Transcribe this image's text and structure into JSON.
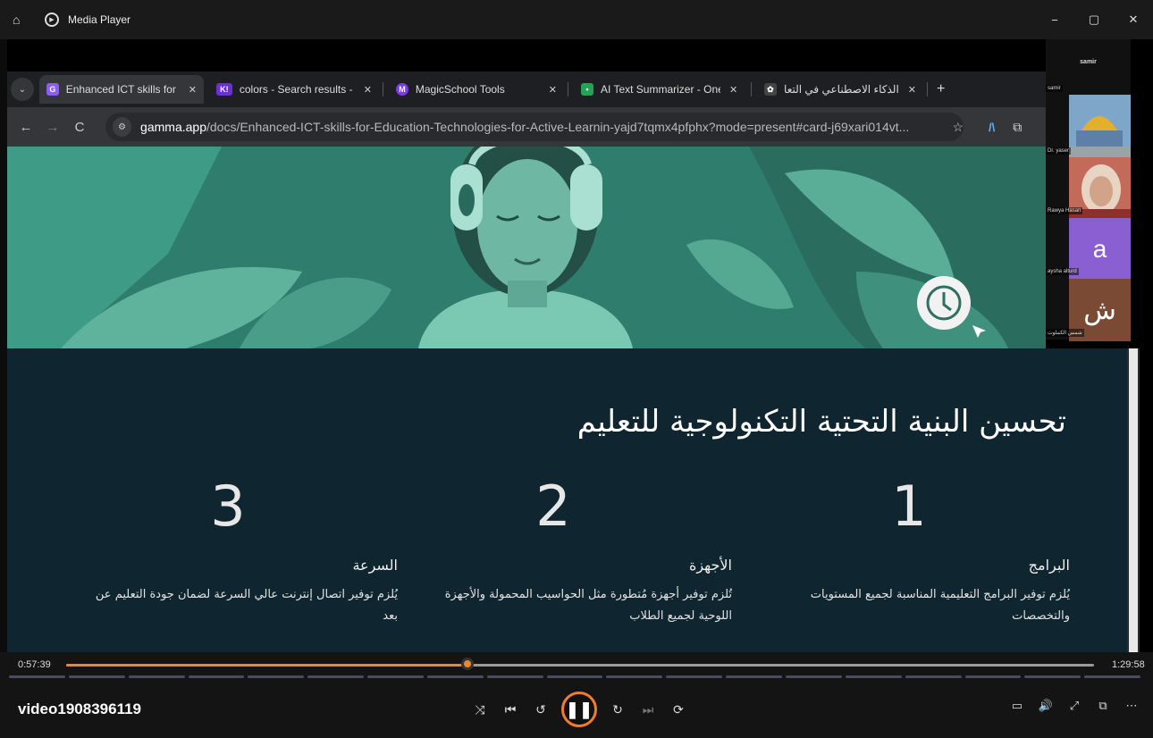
{
  "window": {
    "app_title": "Media Player",
    "minimize": "−",
    "maximize": "▢",
    "close": "✕"
  },
  "browser": {
    "tabs": [
      {
        "title": "Enhanced ICT skills for Ed",
        "favicon": "G",
        "favicon_color": "#8b5cf6",
        "active": true
      },
      {
        "title": "colors - Search results - I",
        "favicon": "K!",
        "favicon_color": "#6b2fd8",
        "active": false
      },
      {
        "title": "MagicSchool Tools",
        "favicon": "M",
        "favicon_color": "#7c3aed",
        "active": false
      },
      {
        "title": "AI Text Summarizer - One",
        "favicon": "▪",
        "favicon_color": "#22a355",
        "active": false
      },
      {
        "title": "الذكاء الاصطناعي في التعا",
        "favicon": "✿",
        "favicon_color": "#444",
        "active": false
      }
    ],
    "close_tab": "✕",
    "new_tab": "+",
    "url_host": "gamma.app",
    "url_path": "/docs/Enhanced-ICT-skills-for-Education-Technologies-for-Active-Learnin-yajd7tqmx4pfphx?mode=present#card-j69xari014vt...",
    "back": "←",
    "forward": "→",
    "reload": "C",
    "bookmark": "☆"
  },
  "participants": {
    "host_name": "samir",
    "tiles": [
      {
        "name": "samir",
        "letter": "",
        "color": "#87a5bf"
      },
      {
        "name": "Dr. yaser",
        "letter": "",
        "color": "#c7bfae"
      },
      {
        "name": "Rawya Hasan",
        "letter": "",
        "color": "#b6524e"
      },
      {
        "name": "aysha alturd",
        "letter": "a",
        "color": "#8a5fd1"
      },
      {
        "name": "شمس الكملوت",
        "letter": "ش",
        "color": "#7a4a35"
      }
    ]
  },
  "slide": {
    "title": "تحسين البنية التحتية التكنولوجية للتعليم",
    "columns": [
      {
        "number": "1",
        "heading": "البرامج",
        "body": "يُلزم توفير البرامج التعليمية المناسبة لجميع المستويات والتخصصات"
      },
      {
        "number": "2",
        "heading": "الأجهزة",
        "body": "تُلزم توفير أجهزة مُتطورة مثل الحواسيب المحمولة والأجهزة اللوحية لجميع الطلاب"
      },
      {
        "number": "3",
        "heading": "السرعة",
        "body": "يُلزم توفير اتصال إنترنت عالي السرعة لضمان جودة التعليم عن بعد"
      }
    ]
  },
  "player": {
    "current_time": "0:57:39",
    "total_time": "1:29:58",
    "progress_fraction": 0.39,
    "video_title": "video1908396119",
    "shuffle": "⤨",
    "previous": "⏮",
    "rewind_10": "↺",
    "pause": "❚❚",
    "forward_30": "↻",
    "next": "⏭",
    "repeat": "⟳",
    "subtitles": "▭",
    "volume": "🔊",
    "fullscreen": "⤢",
    "miniplayer": "⧉",
    "more": "⋯",
    "accent": "#f0862c"
  }
}
